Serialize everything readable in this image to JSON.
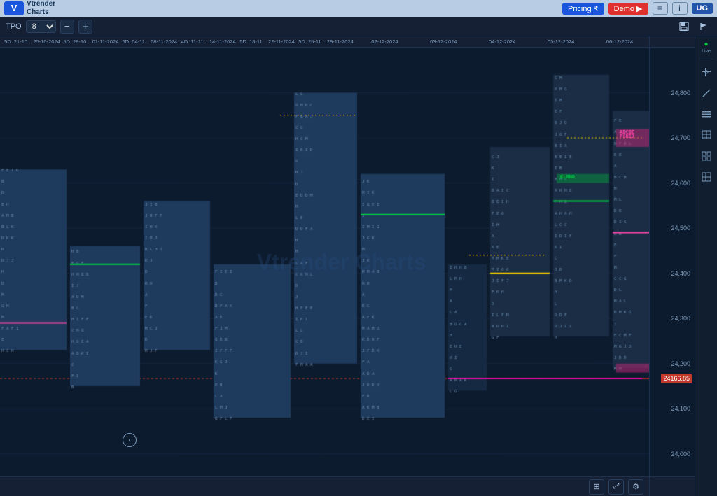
{
  "topnav": {
    "logo_text": "Vtrender\nCharts",
    "pricing_label": "Pricing ₹",
    "demo_label": "Demo ▶",
    "info_label": "i",
    "ug_label": "UG"
  },
  "toolbar": {
    "tpo_label": "TPO",
    "tpo_value": "8",
    "minimize_label": "−",
    "maximize_label": "+",
    "live_label": "Live"
  },
  "date_ticks": [
    "5D: 21-10 .. 25-10-2024",
    "5D: 28-10 .. 01-11-2024",
    "5D: 04-11 .. 08-11-2024",
    "4D: 11-11 .. 14-11-2024",
    "5D: 18-11 .. 22-11-2024",
    "5D: 25-11 .. 29-11-2024",
    "02-12-2024",
    "03-12-2024",
    "04-12-2024",
    "05-12-2024",
    "06-12-2024"
  ],
  "price_levels": [
    {
      "price": "24800",
      "pct": 12
    },
    {
      "price": "24700",
      "pct": 26
    },
    {
      "price": "24600",
      "pct": 40
    },
    {
      "price": "24500",
      "pct": 52
    },
    {
      "price": "24400",
      "pct": 65
    },
    {
      "price": "24300",
      "pct": 75
    },
    {
      "price": "24200",
      "pct": 84
    },
    {
      "price": "24100",
      "pct": 91
    },
    {
      "price": "24000",
      "pct": 98
    }
  ],
  "highlight_price": "24166.85",
  "highlight_pct": 88,
  "watermark": "Vtrender Charts",
  "bottom_toolbar": {
    "grid_label": "⊞",
    "expand_label": "⤢",
    "settings_label": "⚙"
  },
  "sidebar_items": [
    {
      "name": "live",
      "label": "Live",
      "icon": "●"
    },
    {
      "name": "cursor",
      "label": "",
      "icon": "⊹"
    },
    {
      "name": "line",
      "label": "",
      "icon": "╱"
    },
    {
      "name": "menu",
      "label": "",
      "icon": "≡"
    },
    {
      "name": "grid",
      "label": "",
      "icon": "⊞"
    },
    {
      "name": "tiles",
      "label": "",
      "icon": "⊟"
    },
    {
      "name": "panel",
      "label": "",
      "icon": "▣"
    }
  ],
  "colors": {
    "background": "#0d1b2e",
    "toolbar": "#152035",
    "accent_green": "#00cc44",
    "accent_pink": "#ff44aa",
    "accent_yellow": "#eecc00",
    "accent_blue": "#4488ff",
    "price_highlight": "#c0392b"
  }
}
